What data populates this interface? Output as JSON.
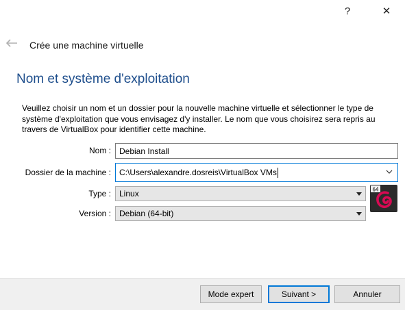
{
  "window": {
    "help_label": "?",
    "close_label": "✕"
  },
  "header": {
    "title": "Crée une machine virtuelle",
    "back_icon": "arrow-left-icon"
  },
  "page": {
    "heading": "Nom et système d'exploitation",
    "description": "Veuillez choisir un nom et un dossier pour la nouvelle machine virtuelle et sélectionner le type de système d'exploitation que vous envisagez d'y installer. Le nom que vous choisirez sera repris au travers de VirtualBox pour identifier cette machine."
  },
  "form": {
    "name_label": "Nom :",
    "name_value": "Debian Install",
    "folder_label": "Dossier de la machine :",
    "folder_value": "C:\\Users\\alexandre.dosreis\\VirtualBox VMs",
    "type_label": "Type :",
    "type_value": "Linux",
    "version_label": "Version :",
    "version_value": "Debian (64-bit)",
    "os_badge": "64"
  },
  "buttons": {
    "expert": "Mode expert",
    "next": "Suivant >",
    "cancel": "Annuler"
  },
  "colors": {
    "heading": "#1e4e8c",
    "focus": "#0078d7",
    "debian_red": "#d70a53"
  }
}
